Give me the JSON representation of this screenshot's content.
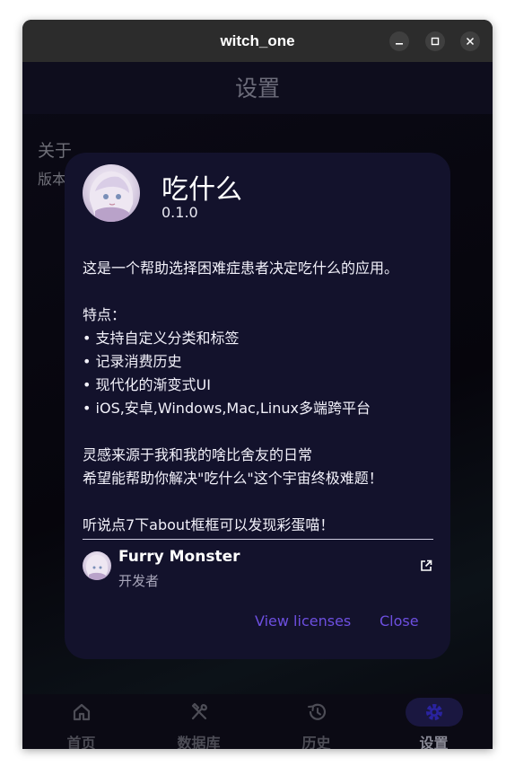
{
  "window": {
    "title": "witch_one"
  },
  "appbar": {
    "title": "设置"
  },
  "settings": {
    "about_heading": "关于",
    "version_label_partial": "版本"
  },
  "bottom_nav": {
    "items": [
      {
        "label": "首页",
        "icon": "home-icon",
        "active": false
      },
      {
        "label": "数据库",
        "icon": "utensils-icon",
        "active": false
      },
      {
        "label": "历史",
        "icon": "history-icon",
        "active": false
      },
      {
        "label": "设置",
        "icon": "gear-icon",
        "active": true
      }
    ]
  },
  "dialog": {
    "app_name": "吃什么",
    "version": "0.1.0",
    "description": {
      "intro": "这是一个帮助选择困难症患者决定吃什么的应用。",
      "features_heading": "特点：",
      "features": [
        "• 支持自定义分类和标签",
        "• 记录消费历史",
        "• 现代化的渐变式UI",
        "• iOS,安卓,Windows,Mac,Linux多端跨平台"
      ],
      "inspiration": "灵感来源于我和我的啥比舍友的日常",
      "hope": "希望能帮助你解决\"吃什么\"这个宇宙终极难题！",
      "easter_egg": "听说点7下about框框可以发现彩蛋喵！"
    },
    "developer": {
      "name": "Furry Monster",
      "role": "开发者"
    },
    "actions": {
      "licenses": "View licenses",
      "close": "Close"
    }
  },
  "colors": {
    "accent": "#6d4fe0",
    "dialog_bg": "#13122c",
    "titlebar_bg": "#2c2c2c",
    "nav_active_pill": "#1a1740"
  }
}
